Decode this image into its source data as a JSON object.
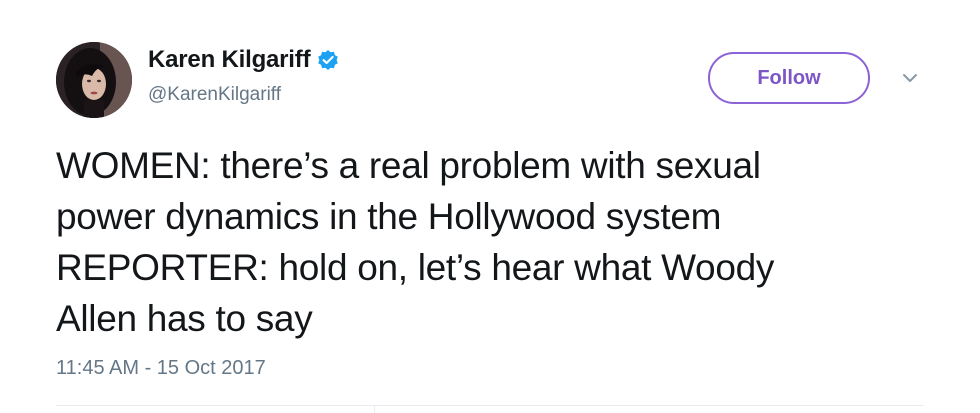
{
  "author": {
    "display_name": "Karen Kilgariff",
    "handle": "@KarenKilgariff",
    "verified": true,
    "avatar_icon": "user-photo-avatar"
  },
  "actions": {
    "follow_label": "Follow",
    "menu_icon": "chevron-down-icon"
  },
  "tweet": {
    "lines": [
      "WOMEN: there’s a real problem with sexual",
      "power dynamics in the Hollywood system",
      "REPORTER: hold on, let’s hear what Woody",
      "Allen has to say"
    ],
    "timestamp": "11:45 AM - 15 Oct 2017"
  },
  "colors": {
    "verified_blue": "#1da1f2",
    "follow_accent": "#7d55c7",
    "text_primary": "#14171a",
    "text_secondary": "#657786"
  }
}
